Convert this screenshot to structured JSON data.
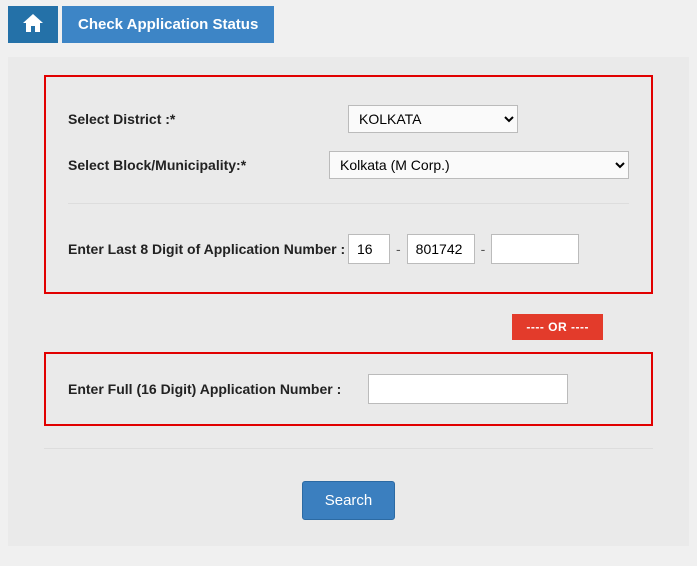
{
  "header": {
    "title": "Check Application Status"
  },
  "form": {
    "district_label": "Select District :*",
    "district_value": "KOLKATA",
    "block_label": "Select Block/Municipality:*",
    "block_value": "Kolkata (M Corp.)",
    "last8_label": "Enter Last 8 Digit of Application Number :",
    "part1": "16",
    "part2": "801742",
    "part3": "",
    "dash": "-",
    "or_text": "---- OR ----",
    "full_label": "Enter Full (16 Digit) Application Number :",
    "full_value": "",
    "search_label": "Search"
  }
}
